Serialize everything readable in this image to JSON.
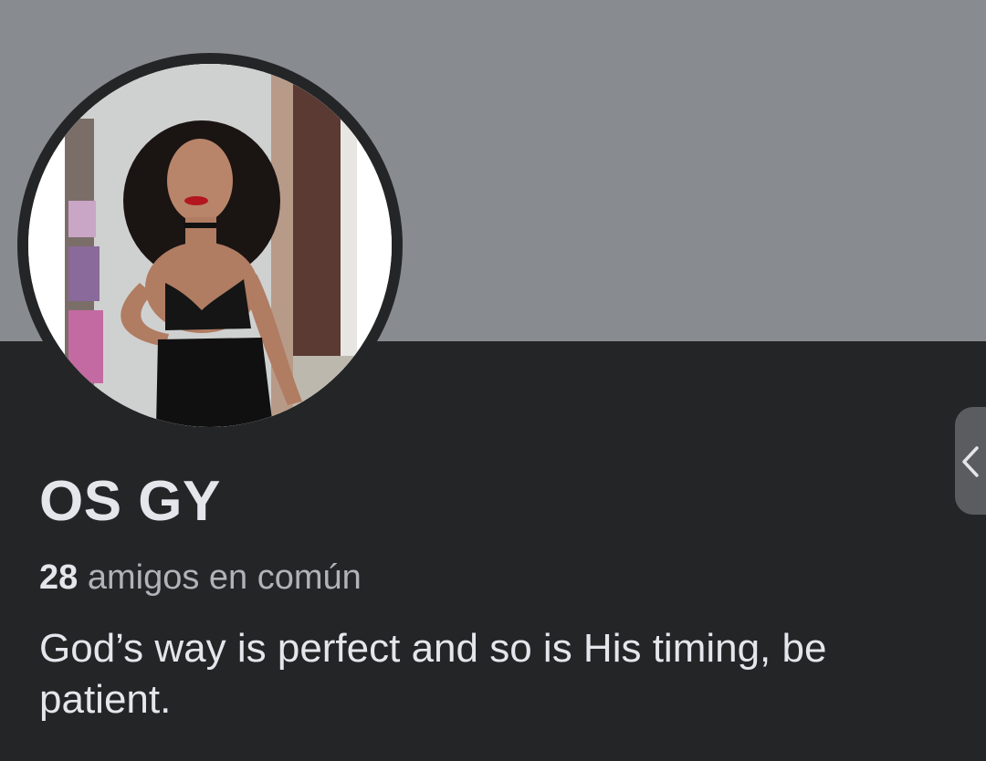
{
  "profile": {
    "name": "OS GY",
    "mutual_count": "28",
    "mutual_label": "amigos en común",
    "bio": "God’s way is perfect and so is His timing, be patient."
  },
  "icons": {
    "side_tab": "chevron-left-icon"
  },
  "colors": {
    "cover": "#888b90",
    "background": "#242527",
    "primary_text": "#e4e6eb",
    "secondary_text": "#b0b3b8"
  }
}
